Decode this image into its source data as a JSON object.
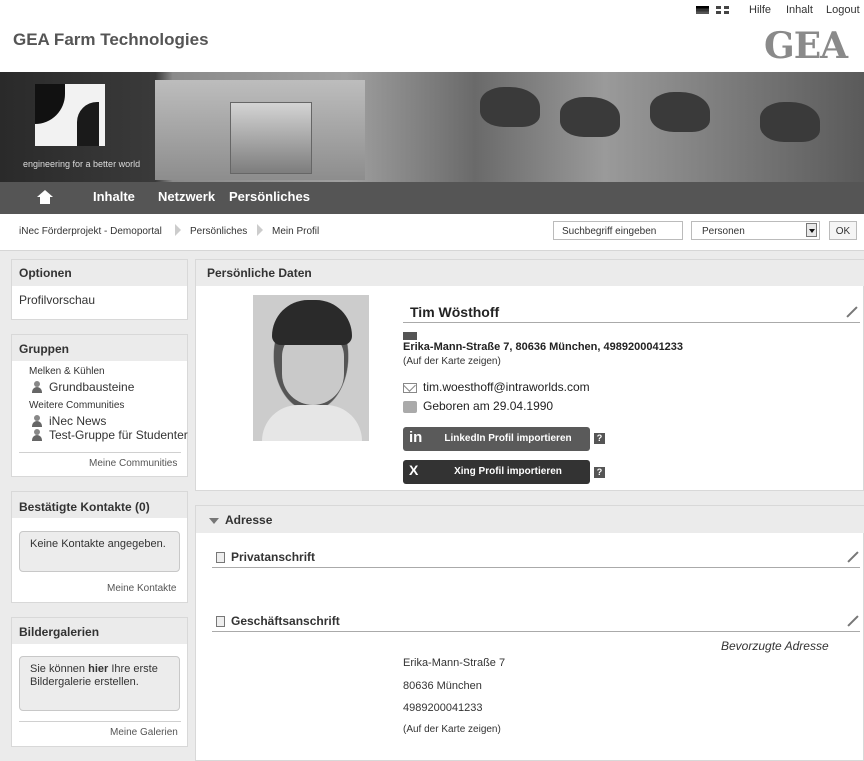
{
  "toplinks": {
    "help": "Hilfe",
    "content": "Inhalt",
    "logout": "Logout"
  },
  "header": {
    "brand": "GEA Farm Technologies",
    "logo": "GEA",
    "tagline": "engineering for a better world"
  },
  "nav": {
    "items": [
      "Inhalte",
      "Netzwerk",
      "Persönliches"
    ]
  },
  "breadcrumb": [
    "iNec Förderprojekt - Demoportal",
    "Persönliches",
    "Mein Profil"
  ],
  "search": {
    "placeholder": "Suchbegriff eingeben",
    "scope": "Personen",
    "ok": "OK"
  },
  "sidebar": {
    "options": {
      "title": "Optionen",
      "item": "Profilvorschau"
    },
    "groups": {
      "title": "Gruppen",
      "cat1": "Melken & Kühlen",
      "g1": "Grundbausteine",
      "cat2": "Weitere Communities",
      "g2": "iNec News",
      "g3": "Test-Gruppe für Studenter",
      "link": "Meine Communities"
    },
    "contacts": {
      "title": "Bestätigte Kontakte (0)",
      "message": "Keine Kontakte angegeben.",
      "link": "Meine Kontakte"
    },
    "galleries": {
      "title": "Bildergalerien",
      "msg_pre": "Sie können",
      "msg_bold": "hier",
      "msg_post": "Ihre erste Bildergalerie erstellen.",
      "link": "Meine Galerien"
    }
  },
  "profile": {
    "section_title": "Persönliche Daten",
    "name": "Tim Wösthoff",
    "address": "Erika-Mann-Straße 7, 80636 München, 4989200041233",
    "map_link": "(Auf der Karte zeigen)",
    "email": "tim.woesthoff@intraworlds.com",
    "birth": "Geboren am 29.04.1990",
    "linkedin": "LinkedIn Profil importieren",
    "xing": "Xing Profil importieren",
    "help": "?"
  },
  "address_section": {
    "title": "Adresse",
    "private": "Privatanschrift",
    "business": "Geschäftsanschrift",
    "preferred": "Bevorzugte Adresse",
    "street": "Erika-Mann-Straße 7",
    "city": "80636 München",
    "phone": "4989200041233",
    "map_link": "(Auf der Karte zeigen)"
  }
}
